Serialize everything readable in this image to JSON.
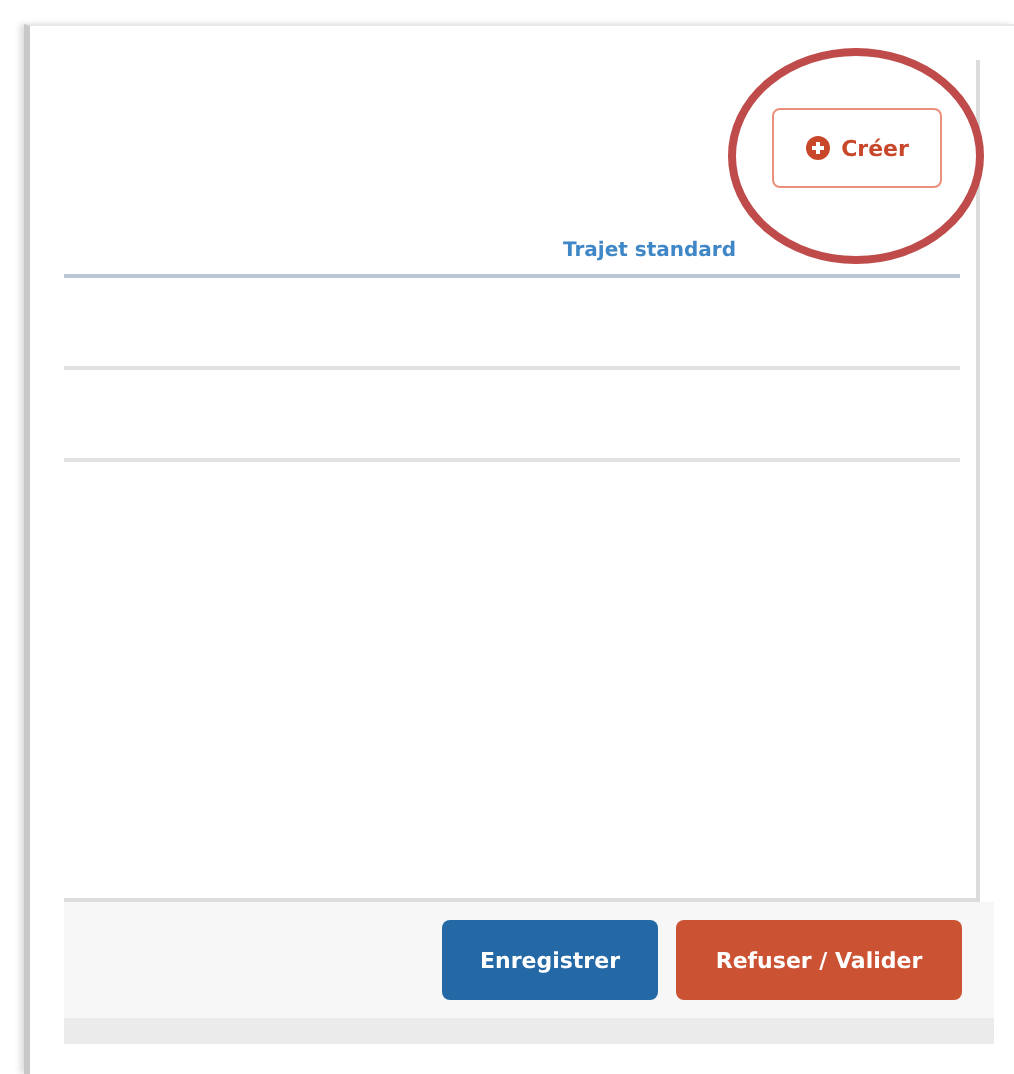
{
  "toolbar": {
    "create_button": {
      "label": "Créer"
    }
  },
  "table": {
    "columns": [
      "Trajet standard"
    ]
  },
  "footer": {
    "buttons": [
      {
        "label": "Enregistrer",
        "kind": "primary"
      },
      {
        "label": "Refuser / Valider",
        "kind": "danger"
      }
    ]
  }
}
